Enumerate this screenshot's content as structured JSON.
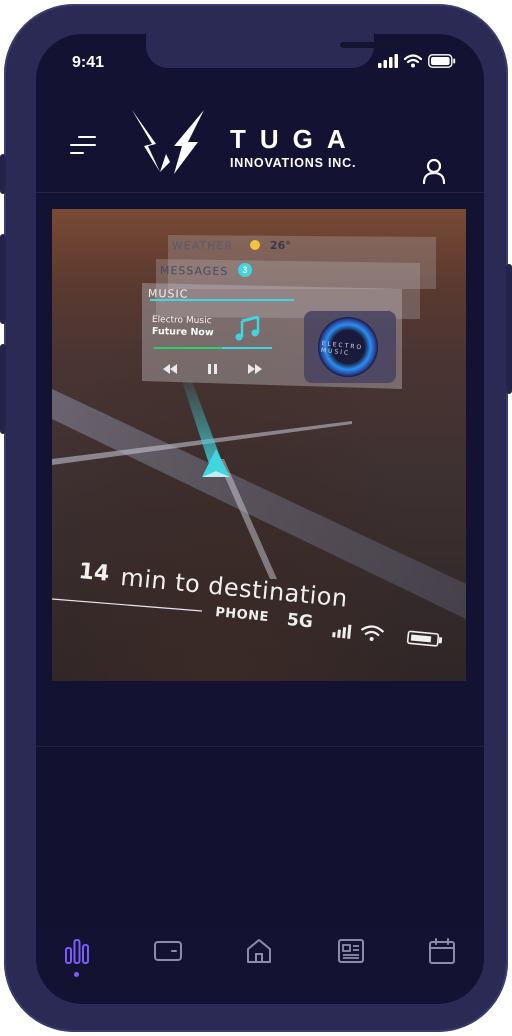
{
  "status_bar": {
    "time": "9:41"
  },
  "brand": {
    "name": "TUGA",
    "subtitle": "INNOVATIONS INC."
  },
  "hud": {
    "cards": [
      {
        "title": "WEATHER",
        "temp": "26°"
      },
      {
        "title": "MESSAGES",
        "badge": "3"
      },
      {
        "title": "MUSIC",
        "artist": "Electro Music",
        "track": "Future Now",
        "album": "ELECTRO MUSIC"
      }
    ],
    "eta_minutes": "14",
    "eta_text": "min to destination",
    "phone_label": "PHONE",
    "network": "5G"
  },
  "tabs": [
    {
      "name": "stats",
      "icon": "bar-chart-icon",
      "active": true
    },
    {
      "name": "wallet",
      "icon": "wallet-icon",
      "active": false
    },
    {
      "name": "home",
      "icon": "home-icon",
      "active": false
    },
    {
      "name": "news",
      "icon": "newspaper-icon",
      "active": false
    },
    {
      "name": "calendar",
      "icon": "calendar-icon",
      "active": false
    }
  ],
  "colors": {
    "accent": "#7b5cff",
    "background": "#141233",
    "frame": "#2a2a54",
    "hud_cyan": "#3fd6e0"
  }
}
